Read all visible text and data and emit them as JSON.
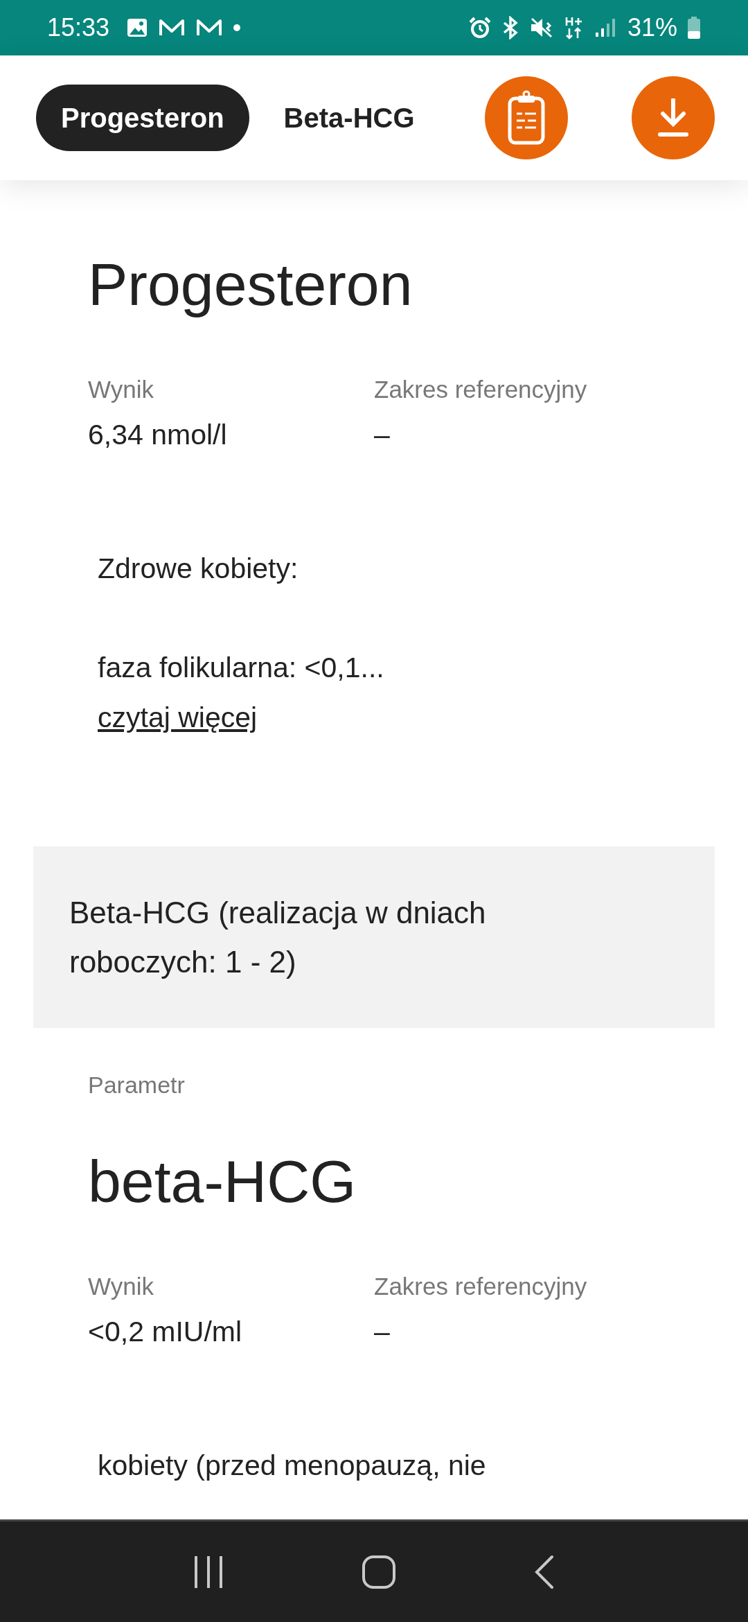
{
  "status_bar": {
    "time": "15:33",
    "battery": "31%"
  },
  "tabs": [
    {
      "label": "Progesteron",
      "selected": true
    },
    {
      "label": "Beta-HCG",
      "selected": false
    }
  ],
  "sections": [
    {
      "kind": "result",
      "name": "Progesteron",
      "result_label": "Wynik",
      "result": "6,34 nmol/l",
      "range_label": "Zakres referencyjny",
      "range": "–",
      "note_lines": [
        "Zdrowe kobiety:",
        "faza folikularna: <0,1..."
      ],
      "link": "czytaj więcej"
    },
    {
      "kind": "group",
      "text": "Beta-HCG (realizacja w dniach roboczych: 1 - 2)"
    },
    {
      "kind": "result",
      "parameter_label": "Parametr",
      "name": "beta-HCG",
      "result_label": "Wynik",
      "result": "<0,2 mIU/ml",
      "range_label": "Zakres referencyjny",
      "range": "–",
      "note_lines": [
        "kobiety (przed menopauzą, nie"
      ]
    }
  ]
}
